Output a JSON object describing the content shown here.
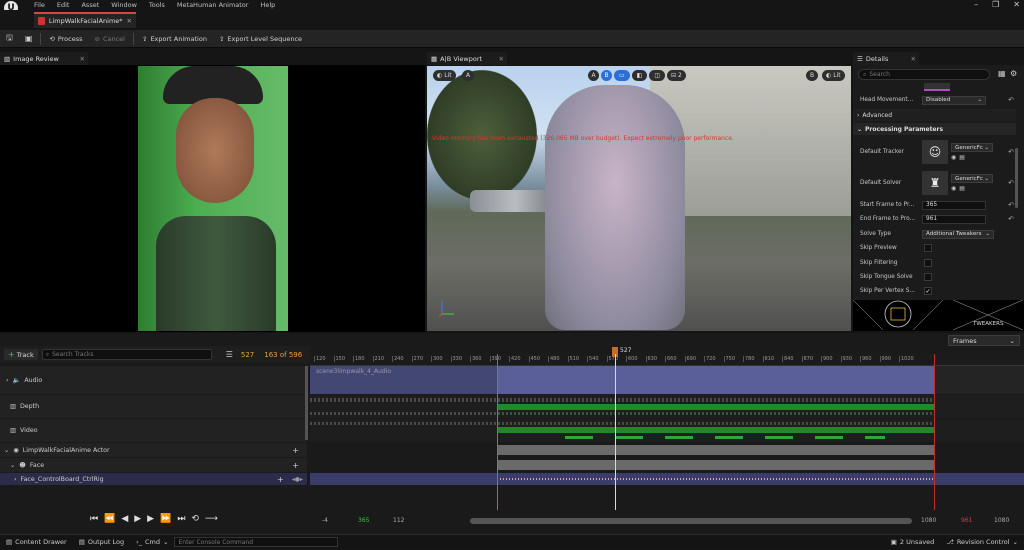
{
  "app": {
    "logo": "U",
    "menu": [
      "File",
      "Edit",
      "Asset",
      "Window",
      "Tools",
      "MetaHuman Animator",
      "Help"
    ],
    "window_controls": [
      "–",
      "❐",
      "✕"
    ]
  },
  "doc_tab": {
    "label": "LimpWalkFacialAnime*",
    "close": "✕"
  },
  "toolbar": {
    "process": "Process",
    "cancel": "Cancel",
    "export_animation": "Export Animation",
    "export_level_sequence": "Export Level Sequence"
  },
  "image_review": {
    "title": "Image Review",
    "close": "✕"
  },
  "viewport": {
    "title": "A|B Viewport",
    "close": "✕",
    "left_lit": "Lit",
    "left_letter": "A",
    "right_letter": "B",
    "right_lit": "Lit",
    "ab_a": "A",
    "ab_b": "B",
    "split_count": "2",
    "warning": "Video memory has been exhausted (326.065 MB over budget). Expect extremely poor performance."
  },
  "details": {
    "title": "Details",
    "close": "✕",
    "search_placeholder": "Search",
    "head_movement_label": "Head Movement...",
    "head_movement_value": "Disabled",
    "advanced": "Advanced",
    "processing_parameters": "Processing Parameters",
    "default_tracker_label": "Default Tracker",
    "default_tracker_value": "GenericFc",
    "default_solver_label": "Default Solver",
    "default_solver_value": "GenericFc",
    "start_frame_label": "Start Frame to Pr...",
    "start_frame_value": "365",
    "end_frame_label": "End Frame to Pro...",
    "end_frame_value": "961",
    "solve_type_label": "Solve Type",
    "solve_type_value": "Additional Tweakers",
    "skip_preview": "Skip Preview",
    "skip_filtering": "Skip Filtering",
    "skip_tongue_solve": "Skip Tongue Solve",
    "skip_per_vertex": "Skip Per Vertex S...",
    "tweakers_label": "TWEAKERS"
  },
  "sequencer": {
    "add_track": "Track",
    "search_placeholder": "Search Tracks",
    "current_frame": "527",
    "frame_count": "163 of 596",
    "playhead": "527",
    "frames_dropdown": "Frames",
    "ruler_ticks": [
      "120",
      "150",
      "180",
      "210",
      "240",
      "270",
      "300",
      "330",
      "360",
      "390",
      "420",
      "450",
      "480",
      "510",
      "540",
      "570",
      "600",
      "630",
      "660",
      "690",
      "720",
      "750",
      "780",
      "810",
      "840",
      "870",
      "900",
      "930",
      "960",
      "990",
      "1020"
    ],
    "tracks": [
      {
        "label": "Audio"
      },
      {
        "label": "Depth"
      },
      {
        "label": "Video"
      },
      {
        "label": "LimpWalkFacialAnime Actor"
      },
      {
        "label": "Face"
      },
      {
        "label": "Face_ControlBoard_CtrlRig"
      }
    ],
    "audio_clip_label": "scene3limpwalk_4_Audio",
    "range_left": "-4",
    "range_start": "365",
    "range_mid": "112",
    "range_right_1": "1080",
    "range_end": "961",
    "range_right_2": "1080"
  },
  "statusbar": {
    "content_drawer": "Content Drawer",
    "output_log": "Output Log",
    "cmd": "Cmd",
    "console_placeholder": "Enter Console Command",
    "unsaved": "2 Unsaved",
    "revision_control": "Revision Control"
  },
  "colors": {
    "accent_red": "#d44444",
    "timeline_green": "#1f8a2a",
    "audio_clip": "#5a5f9a",
    "selected_row": "#3a3d6a"
  }
}
